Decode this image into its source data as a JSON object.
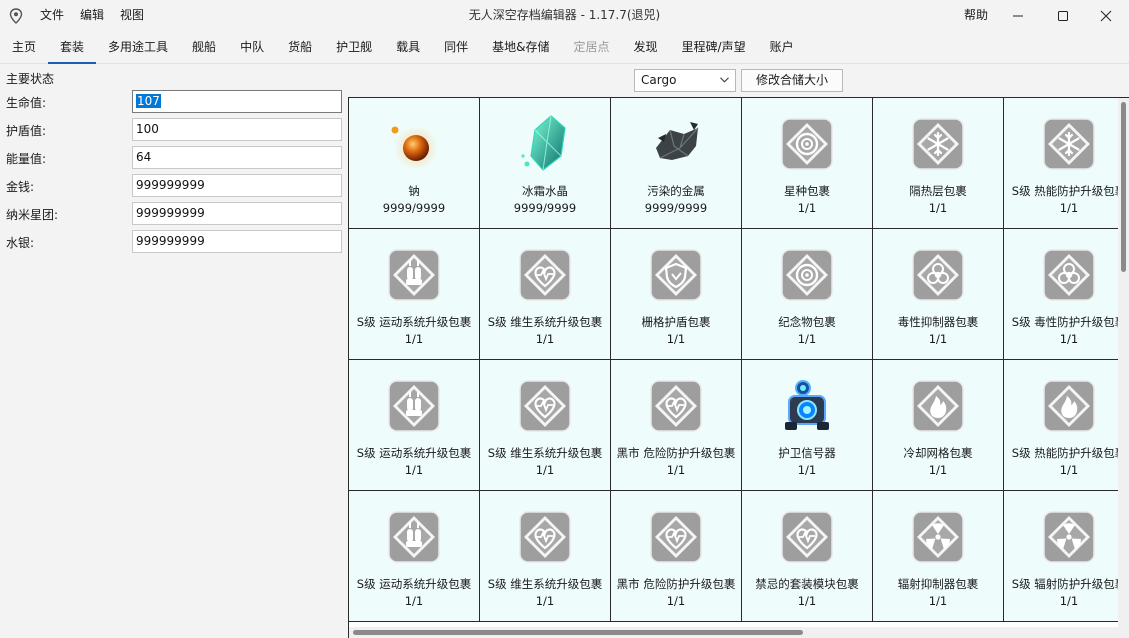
{
  "menu": [
    "文件",
    "编辑",
    "视图"
  ],
  "window": {
    "title": "无人深空存档编辑器 - 1.17.7(退兕)",
    "help_label": "帮助"
  },
  "tabs": [
    {
      "label": "主页"
    },
    {
      "label": "套装"
    },
    {
      "label": "多用途工具"
    },
    {
      "label": "舰船"
    },
    {
      "label": "中队"
    },
    {
      "label": "货船"
    },
    {
      "label": "护卫舰"
    },
    {
      "label": "载具"
    },
    {
      "label": "同伴"
    },
    {
      "label": "基地&存储"
    },
    {
      "label": "定居点"
    },
    {
      "label": "发现"
    },
    {
      "label": "里程碑/声望"
    },
    {
      "label": "账户"
    }
  ],
  "stats": {
    "title": "主要状态",
    "rows": [
      {
        "label": "生命值:",
        "value": "107"
      },
      {
        "label": "护盾值:",
        "value": "100"
      },
      {
        "label": "能量值:",
        "value": "64"
      },
      {
        "label": "金钱:",
        "value": "999999999"
      },
      {
        "label": "纳米星团:",
        "value": "999999999"
      },
      {
        "label": "水银:",
        "value": "999999999"
      }
    ]
  },
  "toolbar": {
    "inventory_select": "Cargo",
    "resize_button": "修改合储大小"
  },
  "inventory": {
    "items": [
      {
        "name": "钠",
        "qty": "9999/9999",
        "icon": "sodium-icon"
      },
      {
        "name": "冰霜水晶",
        "qty": "9999/9999",
        "icon": "frost-crystal-icon"
      },
      {
        "name": "污染的金属",
        "qty": "9999/9999",
        "icon": "metal-scrap-icon"
      },
      {
        "name": "星种包裹",
        "qty": "1/1",
        "icon": "target-package-icon"
      },
      {
        "name": "隔热层包裹",
        "qty": "1/1",
        "icon": "snowflake-package-icon"
      },
      {
        "name": "S级 热能防护升级包裹",
        "qty": "1/1",
        "icon": "snowflake-package-icon"
      },
      {
        "name": "S级 运动系统升级包裹",
        "qty": "1/1",
        "icon": "movement-package-icon"
      },
      {
        "name": "S级 维生系统升级包裹",
        "qty": "1/1",
        "icon": "heart-package-icon"
      },
      {
        "name": "栅格护盾包裹",
        "qty": "1/1",
        "icon": "shield-package-icon"
      },
      {
        "name": "纪念物包裹",
        "qty": "1/1",
        "icon": "target-package-icon"
      },
      {
        "name": "毒性抑制器包裹",
        "qty": "1/1",
        "icon": "biohazard-package-icon"
      },
      {
        "name": "S级 毒性防护升级包裹",
        "qty": "1/1",
        "icon": "biohazard-package-icon"
      },
      {
        "name": "S级 运动系统升级包裹",
        "qty": "1/1",
        "icon": "movement-package-icon"
      },
      {
        "name": "S级 维生系统升级包裹",
        "qty": "1/1",
        "icon": "heart-package-icon"
      },
      {
        "name": "黑市 危险防护升级包裹",
        "qty": "1/1",
        "icon": "heart-package-icon"
      },
      {
        "name": "护卫信号器",
        "qty": "1/1",
        "icon": "beacon-device-icon"
      },
      {
        "name": "冷却网格包裹",
        "qty": "1/1",
        "icon": "flame-package-icon"
      },
      {
        "name": "S级 热能防护升级包裹",
        "qty": "1/1",
        "icon": "flame-package-icon"
      },
      {
        "name": "S级 运动系统升级包裹",
        "qty": "1/1",
        "icon": "movement-package-icon"
      },
      {
        "name": "S级 维生系统升级包裹",
        "qty": "1/1",
        "icon": "heart-package-icon"
      },
      {
        "name": "黑市 危险防护升级包裹",
        "qty": "1/1",
        "icon": "heart-package-icon"
      },
      {
        "name": "禁忌的套装模块包裹",
        "qty": "1/1",
        "icon": "heart-package-icon"
      },
      {
        "name": "辐射抑制器包裹",
        "qty": "1/1",
        "icon": "radiation-package-icon"
      },
      {
        "name": "S级 辐射防护升级包裹",
        "qty": "1/1",
        "icon": "radiation-package-icon"
      }
    ]
  }
}
